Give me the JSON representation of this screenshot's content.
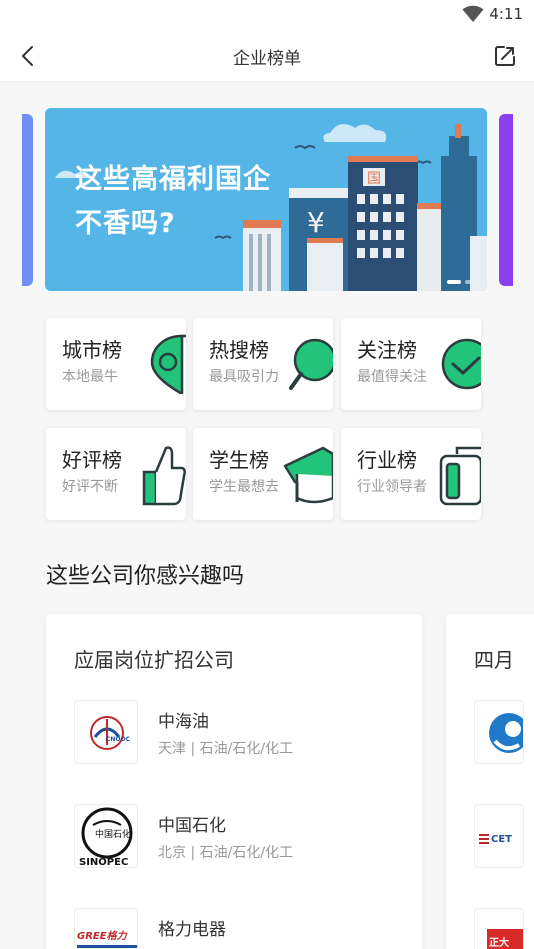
{
  "status_bar": {
    "time": "4:11"
  },
  "nav": {
    "title": "企业榜单"
  },
  "banner": {
    "line1": "这些高福利国企",
    "line2": "不香吗?",
    "building_glyph": "¥",
    "building_sign": "国"
  },
  "ranks": [
    {
      "name": "城市榜",
      "desc": "本地最牛",
      "icon": "location-pin-icon"
    },
    {
      "name": "热搜榜",
      "desc": "最具吸引力",
      "icon": "magnifier-icon"
    },
    {
      "name": "关注榜",
      "desc": "最值得关注",
      "icon": "check-circle-icon"
    },
    {
      "name": "好评榜",
      "desc": "好评不断",
      "icon": "thumbs-up-icon"
    },
    {
      "name": "学生榜",
      "desc": "学生最想去",
      "icon": "graduation-cap-icon"
    },
    {
      "name": "行业榜",
      "desc": "行业领导者",
      "icon": "briefcase-icon"
    }
  ],
  "section_title": "这些公司你感兴趣吗",
  "cards": [
    {
      "title": "应届岗位扩招公司",
      "companies": [
        {
          "name": "中海油",
          "meta": "天津 | 石油/石化/化工",
          "logo_text": "CNOOC"
        },
        {
          "name": "中国石化",
          "meta": "北京 | 石油/石化/化工",
          "logo_text": "SINOPEC"
        },
        {
          "name": "格力电器",
          "meta": "",
          "logo_text": "GREE格力"
        }
      ]
    },
    {
      "title": "四月",
      "companies": [
        {
          "logo_text": ""
        },
        {
          "logo_text": "CET"
        },
        {
          "logo_text": "正大"
        }
      ]
    }
  ],
  "colors": {
    "accent_green": "#21c47a",
    "banner_sky": "#54b5e6",
    "icon_stroke": "#2c3b3d"
  }
}
